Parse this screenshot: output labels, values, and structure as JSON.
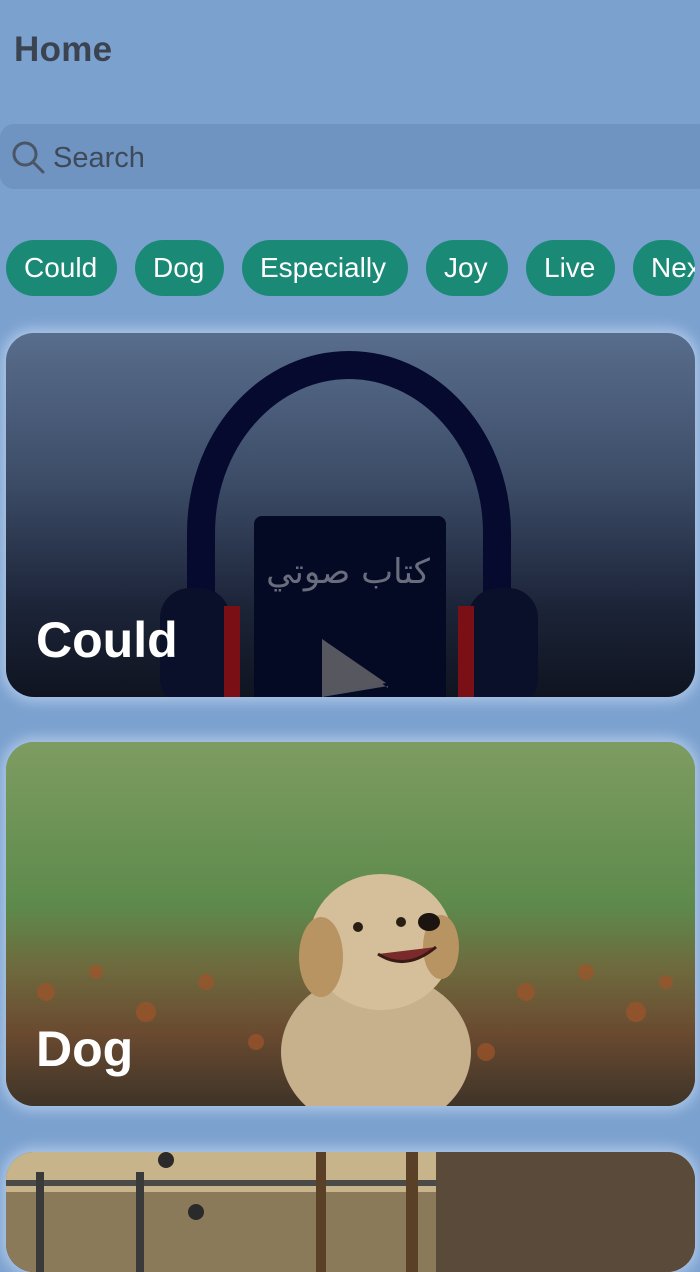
{
  "header": {
    "title": "Home"
  },
  "search": {
    "placeholder": "Search"
  },
  "categories": [
    {
      "label": "Could"
    },
    {
      "label": "Dog"
    },
    {
      "label": "Especially"
    },
    {
      "label": "Joy"
    },
    {
      "label": "Live"
    },
    {
      "label": "Next"
    }
  ],
  "cards": [
    {
      "title": "Could",
      "image_text": "كتاب صوتي",
      "image": "audiobook-headphones"
    },
    {
      "title": "Dog",
      "image": "puppy-in-field"
    },
    {
      "title": "",
      "image": "outdoor-scene"
    }
  ],
  "colors": {
    "background": "#7ba1cf",
    "chip": "#1a8a77",
    "search_bar": "#6f94c1",
    "title_text": "#3b4350"
  }
}
